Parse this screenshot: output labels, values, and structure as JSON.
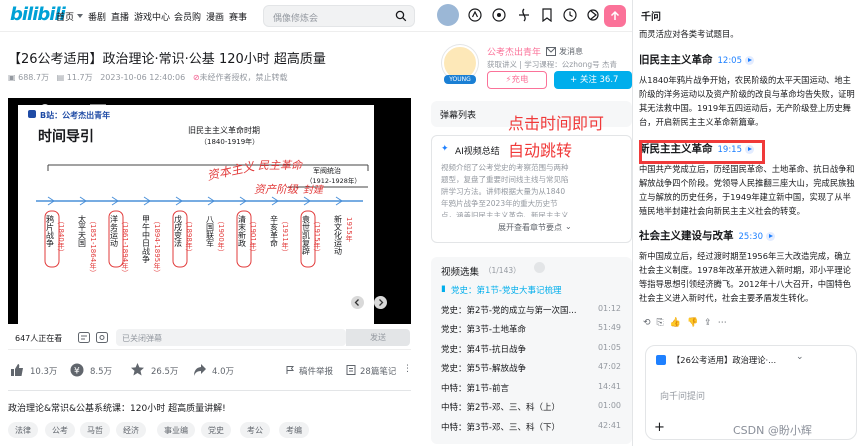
{
  "header": {
    "logo": "bilibili",
    "nav": [
      "首页",
      "番剧",
      "直播",
      "游戏中心",
      "会员购",
      "漫画",
      "赛事"
    ],
    "search_placeholder": "偶像修炼会"
  },
  "video": {
    "title": "【26公考适用】政治理论·常识·公基 120小时 超高质量",
    "views": "688.7万",
    "danmaku": "11.7万",
    "date": "2023-10-06 12:40:06",
    "notice": "未经作者授权，禁止转载"
  },
  "slide": {
    "brand": "B站：公考杰出青年",
    "heading": "时间导引",
    "top_label": "旧民主主义革命时期",
    "top_years": "（1840-1919年）",
    "warlord": "军阀统治",
    "warlord_years": "（1912-1928年）",
    "hand1": "资本主义",
    "hand2": "民主革命",
    "hand3": "资产阶级",
    "hand4": "封建",
    "events": [
      "鸦片战争",
      "太平天国",
      "洋务运动",
      "甲午中日战争",
      "戊戌变法",
      "八国联军",
      "清末新政",
      "辛亥革命",
      "袁世凯复辟",
      "新文化运动"
    ],
    "years": [
      "（1840年）",
      "（1851-1864年）",
      "（1861-1894年）",
      "（1894-1895年）",
      "（1898年）",
      "（1900年）",
      "（1901年）",
      "（1911年）",
      "（1915年）",
      "1915年"
    ]
  },
  "player": {
    "online": "647人正在看",
    "danmu_closed": "已关闭弹幕",
    "send": "发送"
  },
  "actions": {
    "like": "10.3万",
    "coin": "8.5万",
    "fav": "26.5万",
    "share": "4.0万",
    "report": "稿件举报",
    "notes": "28篇笔记"
  },
  "description": "政治理论&常识&公基系统课：120小时 超高质量讲解!",
  "tags": [
    "法律",
    "公考",
    "马哲",
    "经济",
    "事业编",
    "党史",
    "考公",
    "考编"
  ],
  "uploader": {
    "name": "公考杰出青年",
    "message": "发消息",
    "sub": "获取讲义 | 学习课程：公zhong号 杰青",
    "charge": "充电",
    "follow": "+ 关注 36.7"
  },
  "danmu_list": {
    "title": "弹幕列表"
  },
  "ai_summary": {
    "title": "AI视频总结",
    "text": "视频介绍了公考党史的考察范围与两种题型，复盘了重要时间线主线与常见陷阱学习方法。讲师根据大量为从1840年鸦片战争至2023年的重大历史节点，涵盖旧民主主义革命、新民主主义革命及社会主义...",
    "more": "展开查看章节要点"
  },
  "episodes": {
    "title": "视频选集",
    "count": "（1/143）",
    "items": [
      {
        "name": "党史：第1节-党史大事记梳理",
        "time": "",
        "active": true
      },
      {
        "name": "党史：第2节-党的成立与第一次国...",
        "time": "01:12"
      },
      {
        "name": "党史：第3节-土地革命",
        "time": "51:49"
      },
      {
        "name": "党史：第4节-抗日战争",
        "time": "01:05"
      },
      {
        "name": "党史：第5节-解放战争",
        "time": "47:02"
      },
      {
        "name": "中特：第1节-前言",
        "time": "14:41"
      },
      {
        "name": "中特：第2节-邓、三、科（上）",
        "time": "01:00"
      },
      {
        "name": "中特：第3节-邓、三、科（下）",
        "time": "42:41"
      }
    ]
  },
  "annotation": {
    "line1": "点击时间即可",
    "line2": "自动跳转"
  },
  "qa": {
    "title": "千问",
    "intro": "而灵活应对各类考试题目。",
    "sections": [
      {
        "heading": "旧民主主义革命",
        "time": "12:05",
        "text": "从1840年鸦片战争开始，农民阶级的太平天国运动、地主阶级的洋务运动以及资产阶级的改良与革命均告失败，证明其无法救中国。1919年五四运动后，无产阶级登上历史舞台，开启新民主主义革命新篇章。"
      },
      {
        "heading": "新民主主义革命",
        "time": "19:15",
        "text": "中国共产党成立后，历经国民革命、土地革命、抗日战争和解放战争四个阶段。党领导人民推翻三座大山，完成民族独立与解放的历史任务，于1949年建立新中国，实现了从半殖民地半封建社会向新民主主义社会的转变。"
      },
      {
        "heading": "社会主义建设与改革",
        "time": "25:30",
        "text": "新中国成立后，经过渡时期至1956年三大改造完成，确立社会主义制度。1978年改革开放进入新时期，邓小平理论等指导思想引领经济腾飞。2012年十八大召开，中国特色社会主义进入新时代，社会主要矛盾发生转化。"
      }
    ],
    "chat_ref": "【26公考适用】政治理论·...",
    "input_placeholder": "向千问提问"
  },
  "watermark": "CSDN @盼小辉",
  "colors": {
    "brand": "#00a1d6",
    "pink": "#fb7299",
    "blue": "#00aeec",
    "link": "#1e80ff",
    "annotation": "#f03a3a"
  }
}
